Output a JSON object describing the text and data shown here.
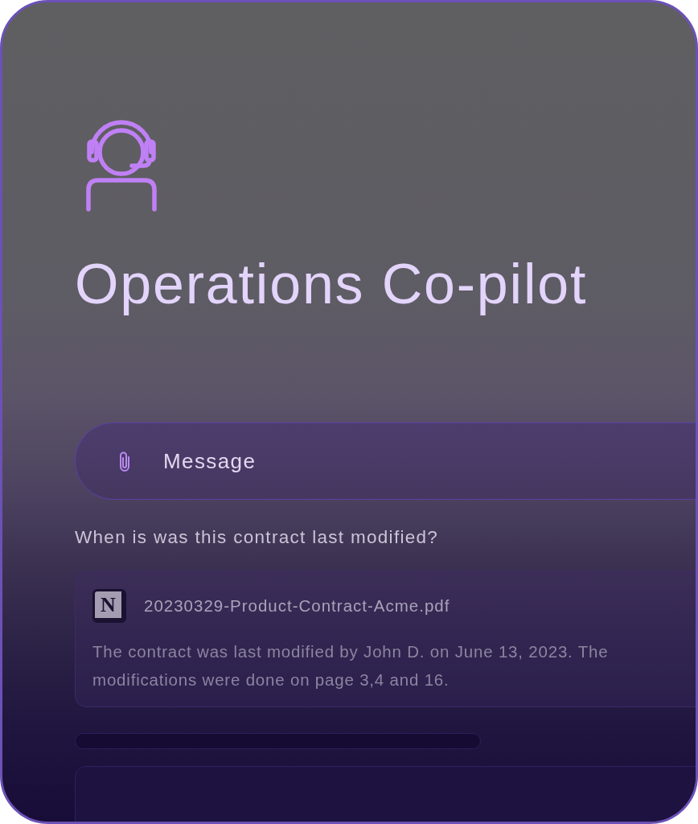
{
  "header": {
    "title": "Operations Co-pilot"
  },
  "message_field": {
    "placeholder": "Message"
  },
  "question": "When is was this contract last modified?",
  "answer": {
    "source_logo": "N",
    "source": "20230329-Product-Contract-Acme.pdf",
    "text": "The contract was last modified by John D. on June 13, 2023. The modifications were done on page 3,4 and 16."
  }
}
